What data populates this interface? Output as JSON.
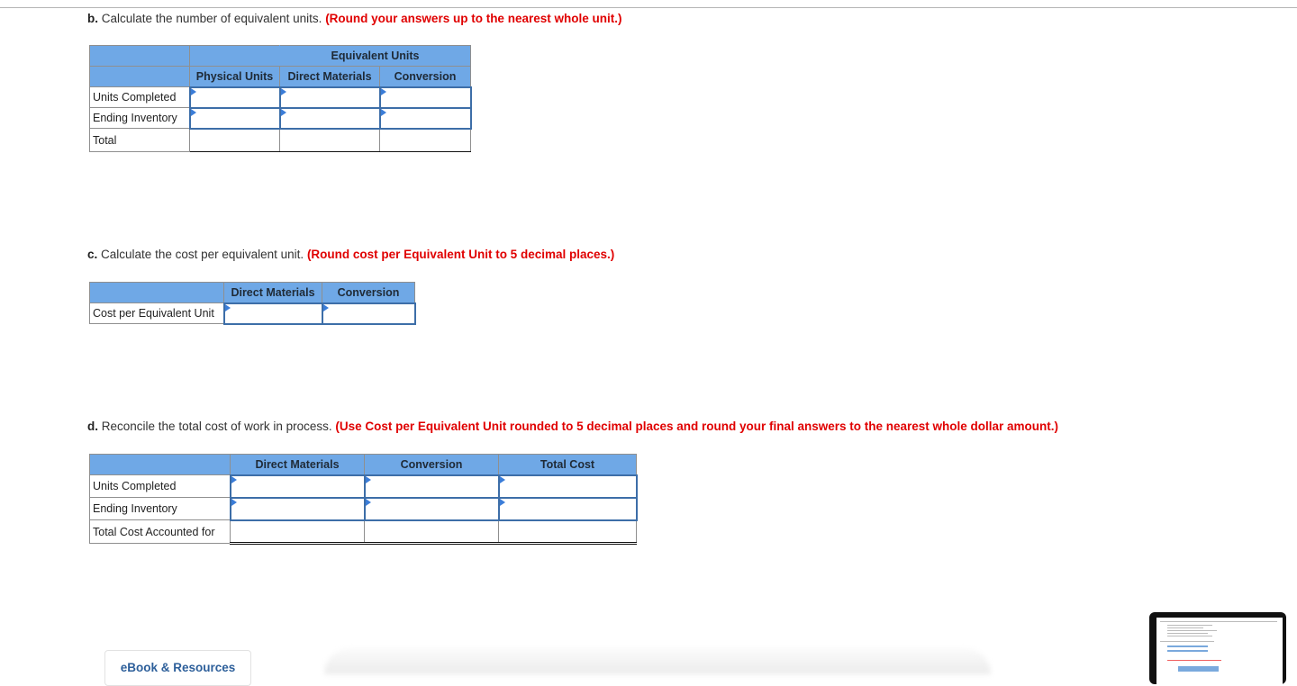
{
  "part_b": {
    "prefix": "b.",
    "text": "Calculate the number of equivalent units.",
    "instruction": "(Round your answers up to the nearest whole unit.)",
    "table": {
      "group_header": "Equivalent Units",
      "columns": [
        "Physical Units",
        "Direct Materials",
        "Conversion"
      ],
      "rows": [
        {
          "label": "Units Completed",
          "values": [
            "",
            "",
            ""
          ],
          "editable": true
        },
        {
          "label": "Ending Inventory",
          "values": [
            "",
            "",
            ""
          ],
          "editable": true
        },
        {
          "label": "Total",
          "values": [
            "",
            "",
            ""
          ],
          "editable": false
        }
      ]
    }
  },
  "part_c": {
    "prefix": "c.",
    "text": "Calculate the cost per equivalent unit.",
    "instruction": "(Round cost per Equivalent Unit to 5 decimal places.)",
    "table": {
      "columns": [
        "Direct Materials",
        "Conversion"
      ],
      "rows": [
        {
          "label": "Cost per Equivalent Unit",
          "values": [
            "",
            ""
          ],
          "editable": true
        }
      ]
    }
  },
  "part_d": {
    "prefix": "d.",
    "text": "Reconcile the total cost of work in process.",
    "instruction": "(Use Cost per Equivalent Unit rounded to 5 decimal places and round your final answers to the nearest whole dollar amount.)",
    "table": {
      "columns": [
        "Direct Materials",
        "Conversion",
        "Total Cost"
      ],
      "rows": [
        {
          "label": "Units Completed",
          "values": [
            "",
            "",
            ""
          ],
          "editable": true
        },
        {
          "label": "Ending Inventory",
          "values": [
            "",
            "",
            ""
          ],
          "editable": true
        },
        {
          "label": "Total Cost Accounted for",
          "values": [
            "",
            "",
            ""
          ],
          "editable": false
        }
      ]
    }
  },
  "footer": {
    "ebook_button": "eBook & Resources"
  },
  "colors": {
    "header_fill": "#6fa8e6",
    "instruction_red": "#e00000",
    "input_border": "#3d6ea8",
    "link_blue": "#2d5f9a"
  }
}
